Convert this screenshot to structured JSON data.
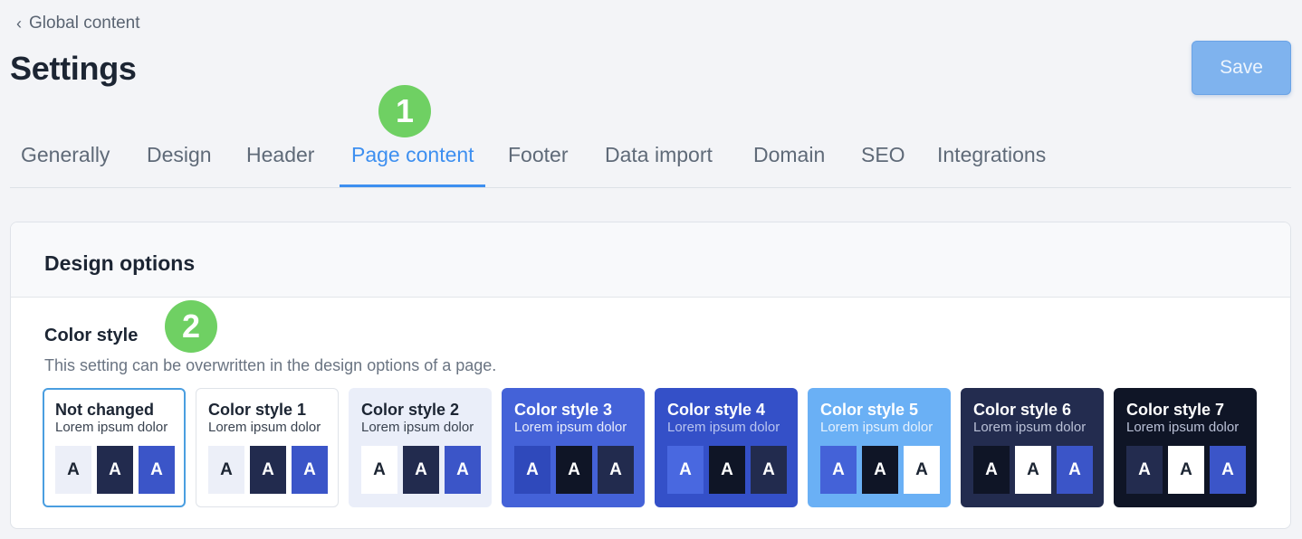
{
  "header": {
    "back_label": "Global content",
    "title": "Settings",
    "save_label": "Save"
  },
  "badges": {
    "one": "1",
    "two": "2"
  },
  "tabs": [
    {
      "label": "Generally",
      "active": false
    },
    {
      "label": "Design",
      "active": false
    },
    {
      "label": "Header",
      "active": false
    },
    {
      "label": "Page content",
      "active": true
    },
    {
      "label": "Footer",
      "active": false
    },
    {
      "label": "Data import",
      "active": false
    },
    {
      "label": "Domain",
      "active": false
    },
    {
      "label": "SEO",
      "active": false
    },
    {
      "label": "Integrations",
      "active": false
    }
  ],
  "card": {
    "title": "Design options",
    "section_title": "Color style",
    "section_desc": "This setting can be overwritten in the design options of a page."
  },
  "styles": [
    {
      "name": "Not changed",
      "sub": "Lorem ipsum dolor",
      "selected": true,
      "bg": "#ffffff",
      "fg": "#1c2533",
      "sub_fg": "#3a4350",
      "swatches": [
        {
          "bg": "#eceff8",
          "fg": "#1c2533",
          "label": "A"
        },
        {
          "bg": "#222b4e",
          "fg": "#ffffff",
          "label": "A"
        },
        {
          "bg": "#3b55c8",
          "fg": "#ffffff",
          "label": "A"
        }
      ]
    },
    {
      "name": "Color style 1",
      "sub": "Lorem ipsum dolor",
      "selected": false,
      "bg": "#ffffff",
      "fg": "#1c2533",
      "sub_fg": "#3a4350",
      "swatches": [
        {
          "bg": "#eceff8",
          "fg": "#1c2533",
          "label": "A"
        },
        {
          "bg": "#222b4e",
          "fg": "#ffffff",
          "label": "A"
        },
        {
          "bg": "#3b55c8",
          "fg": "#ffffff",
          "label": "A"
        }
      ]
    },
    {
      "name": "Color style 2",
      "sub": "Lorem ipsum dolor",
      "selected": false,
      "bg": "#eaeef9",
      "fg": "#1c2533",
      "sub_fg": "#3a4350",
      "swatches": [
        {
          "bg": "#ffffff",
          "fg": "#1c2533",
          "label": "A"
        },
        {
          "bg": "#222b4e",
          "fg": "#ffffff",
          "label": "A"
        },
        {
          "bg": "#3b55c8",
          "fg": "#ffffff",
          "label": "A"
        }
      ]
    },
    {
      "name": "Color style 3",
      "sub": "Lorem ipsum dolor",
      "selected": false,
      "bg": "#4462d8",
      "fg": "#ffffff",
      "sub_fg": "#e6ebfb",
      "swatches": [
        {
          "bg": "#2f49bb",
          "fg": "#ffffff",
          "label": "A"
        },
        {
          "bg": "#0f1526",
          "fg": "#ffffff",
          "label": "A"
        },
        {
          "bg": "#222b4e",
          "fg": "#ffffff",
          "label": "A"
        }
      ]
    },
    {
      "name": "Color style 4",
      "sub": "Lorem ipsum dolor",
      "selected": false,
      "bg": "#3450c8",
      "fg": "#ffffff",
      "sub_fg": "#b8c4ef",
      "swatches": [
        {
          "bg": "#4968e0",
          "fg": "#ffffff",
          "label": "A"
        },
        {
          "bg": "#0f1526",
          "fg": "#ffffff",
          "label": "A"
        },
        {
          "bg": "#222b4e",
          "fg": "#ffffff",
          "label": "A"
        }
      ]
    },
    {
      "name": "Color style 5",
      "sub": "Lorem ipsum dolor",
      "selected": false,
      "bg": "#6ab0f5",
      "fg": "#ffffff",
      "sub_fg": "#e5f1fd",
      "swatches": [
        {
          "bg": "#4462d8",
          "fg": "#ffffff",
          "label": "A"
        },
        {
          "bg": "#0f1526",
          "fg": "#ffffff",
          "label": "A"
        },
        {
          "bg": "#ffffff",
          "fg": "#1c2533",
          "label": "A"
        }
      ]
    },
    {
      "name": "Color style 6",
      "sub": "Lorem ipsum dolor",
      "selected": false,
      "bg": "#232c4f",
      "fg": "#ffffff",
      "sub_fg": "#b9c0d6",
      "swatches": [
        {
          "bg": "#0f1526",
          "fg": "#ffffff",
          "label": "A"
        },
        {
          "bg": "#ffffff",
          "fg": "#1c2533",
          "label": "A"
        },
        {
          "bg": "#3b55c8",
          "fg": "#ffffff",
          "label": "A"
        }
      ]
    },
    {
      "name": "Color style 7",
      "sub": "Lorem ipsum dolor",
      "selected": false,
      "bg": "#0f1526",
      "fg": "#ffffff",
      "sub_fg": "#b9c0d6",
      "swatches": [
        {
          "bg": "#232c4f",
          "fg": "#ffffff",
          "label": "A"
        },
        {
          "bg": "#ffffff",
          "fg": "#1c2533",
          "label": "A"
        },
        {
          "bg": "#3b55c8",
          "fg": "#ffffff",
          "label": "A"
        }
      ]
    }
  ],
  "colors": {
    "accent": "#3d8ff0",
    "badge": "#6fd063",
    "save_bg": "#7fb3ee",
    "selected_border": "#4a9ee0"
  }
}
